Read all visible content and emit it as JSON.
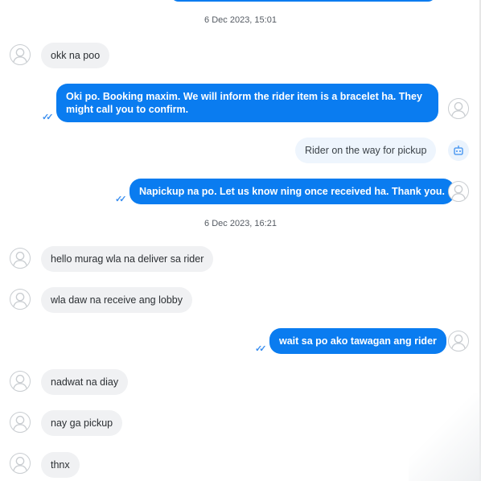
{
  "dates": [
    "6 Dec 2023, 15:01",
    "6 Dec 2023, 16:21"
  ],
  "messages": [
    {
      "text": "okk na poo"
    },
    {
      "text": "Oki po. Booking maxim. We will inform the rider item is a bracelet ha. They might call you to confirm."
    },
    {
      "text": "Rider on the way for pickup"
    },
    {
      "text": "Napickup na po. Let us know ning once received ha. Thank you."
    },
    {
      "text": "hello murag wla na deliver sa rider"
    },
    {
      "text": "wla daw na receive ang lobby"
    },
    {
      "text": "wait sa po ako tawagan ang rider"
    },
    {
      "text": "nadwat na diay"
    },
    {
      "text": "nay ga pickup"
    },
    {
      "text": "thnx"
    }
  ],
  "icons": {
    "avatar": "user-avatar-icon",
    "read_receipt": "double-check-icon",
    "bot": "robot-icon"
  },
  "colors": {
    "outgoing_bubble": "#0a7cf0",
    "incoming_bubble": "#f0f1f3",
    "bot_bubble": "#eef5fd"
  }
}
